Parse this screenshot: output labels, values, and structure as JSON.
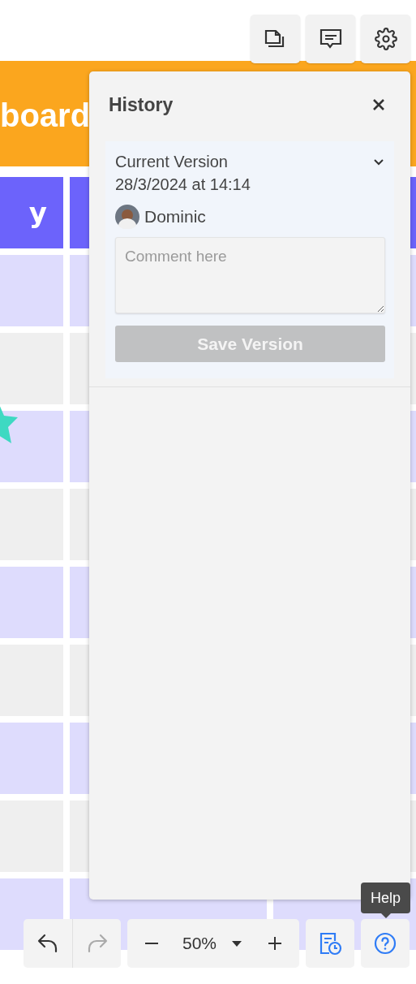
{
  "top_toolbar": {
    "buttons": [
      {
        "kind": "pages"
      },
      {
        "kind": "comments"
      },
      {
        "kind": "settings"
      }
    ]
  },
  "board": {
    "title": "board",
    "headers": [
      "y"
    ],
    "rows": [
      {
        "kind": "tinted"
      },
      {
        "kind": "plain"
      },
      {
        "kind": "tinted"
      },
      {
        "kind": "plain"
      },
      {
        "kind": "tinted"
      },
      {
        "kind": "plain"
      },
      {
        "kind": "tinted"
      },
      {
        "kind": "plain"
      },
      {
        "kind": "tinted"
      }
    ]
  },
  "history_panel": {
    "title": "History",
    "version": {
      "title": "Current Version",
      "date": "28/3/2024 at 14:14",
      "expanded": false,
      "author": "Dominic",
      "comment": {
        "placeholder": "Comment here"
      },
      "save_button": {
        "label": "Save Version",
        "disabled": true
      }
    }
  },
  "bottom_toolbar": {
    "undo": {
      "disabled": false
    },
    "redo": {
      "disabled": true
    },
    "zoom": "50%",
    "tooltip": "Help"
  }
}
